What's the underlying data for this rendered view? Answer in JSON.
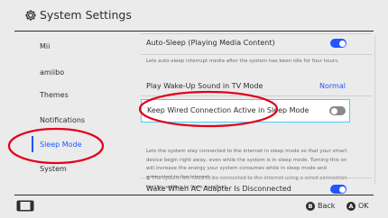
{
  "header": {
    "title": "System Settings",
    "icon": "gear-icon"
  },
  "sidebar": {
    "items": [
      {
        "label": "Mii"
      },
      {
        "label": "amiibo"
      },
      {
        "label": "Themes"
      },
      {
        "label": "Notifications"
      },
      {
        "label": "Sleep Mode",
        "selected": true
      },
      {
        "label": "System"
      }
    ]
  },
  "content": {
    "auto_sleep": {
      "label": "Auto-Sleep (Playing Media Content)",
      "enabled": true,
      "description": "Lets auto-sleep interrupt media after the system has been idle for four hours."
    },
    "wakeup_sound": {
      "label": "Play Wake-Up Sound in TV Mode",
      "value": "Normal"
    },
    "wired_connection": {
      "label": "Keep Wired Connection Active in Sleep Mode",
      "enabled": false,
      "description": "Lets the system stay connected to the internet in sleep mode so that your smart device begin right away, even while the system is in sleep mode. Turning this on will increase the energy your system consumes while in sleep mode and connected to the internet.",
      "note": "◆  The system will need to be connected to the internet using a wired connection for this setting to have an effect."
    },
    "wake_ac": {
      "label": "Wake When AC Adapter Is Disconnected",
      "enabled": true
    }
  },
  "footer": {
    "back_button": "B",
    "back_label": "Back",
    "ok_button": "A",
    "ok_label": "OK"
  },
  "colors": {
    "accent": "#2255ff",
    "highlight_border": "#3fd1ff",
    "annotation": "#e2001a"
  }
}
